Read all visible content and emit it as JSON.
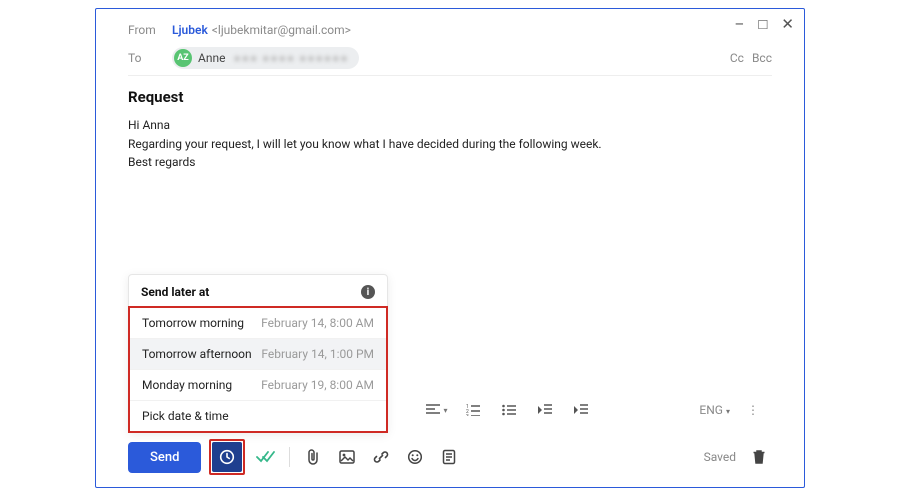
{
  "window": {
    "minimize": "–",
    "maximize": "□",
    "close": "✕"
  },
  "header": {
    "from_label": "From",
    "from_name": "Ljubek",
    "from_email": "<ljubekmitar@gmail.com>",
    "to_label": "To",
    "to_avatar": "AZ",
    "to_name": "Anne",
    "to_blur": "●●●  ●●●●  ●●●●●●",
    "cc": "Cc",
    "bcc": "Bcc"
  },
  "subject": "Request",
  "body": {
    "line1": "Hi Anna",
    "line2": "Regarding your request, I will let you know what I have decided during the following week.",
    "line3": "Best regards"
  },
  "popup": {
    "title": "Send later at",
    "options": [
      {
        "label": "Tomorrow morning",
        "time": "February 14, 8:00 AM"
      },
      {
        "label": "Tomorrow afternoon",
        "time": "February 14, 1:00 PM"
      },
      {
        "label": "Monday morning",
        "time": "February 19, 8:00 AM"
      },
      {
        "label": "Pick date & time",
        "time": ""
      }
    ]
  },
  "toolbar": {
    "send": "Send",
    "lang": "ENG",
    "saved": "Saved"
  }
}
